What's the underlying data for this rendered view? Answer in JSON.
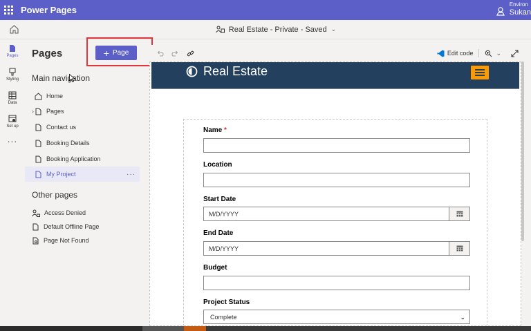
{
  "app": {
    "title": "Power Pages"
  },
  "environment": {
    "label": "Environ",
    "user": "Sukan"
  },
  "site": {
    "status": "Real Estate - Private - Saved"
  },
  "rail": {
    "items": [
      {
        "label": "Pages",
        "icon": "pages-icon"
      },
      {
        "label": "Styling",
        "icon": "brush-icon"
      },
      {
        "label": "Data",
        "icon": "table-icon"
      },
      {
        "label": "Set up",
        "icon": "setup-icon"
      }
    ],
    "more": "..."
  },
  "panel": {
    "title": "Pages",
    "add_button": "Page",
    "main_nav_title": "Main navigation",
    "main_nav": [
      {
        "label": "Home",
        "icon": "home-icon"
      },
      {
        "label": "Pages",
        "icon": "page-icon",
        "expandable": true
      },
      {
        "label": "Contact us",
        "icon": "page-icon"
      },
      {
        "label": "Booking Details",
        "icon": "page-icon"
      },
      {
        "label": "Booking Application",
        "icon": "page-icon"
      },
      {
        "label": "My Project",
        "icon": "page-icon",
        "selected": true
      }
    ],
    "other_title": "Other pages",
    "other_pages": [
      {
        "label": "Access Denied",
        "icon": "person-lock-icon"
      },
      {
        "label": "Default Offline Page",
        "icon": "page-icon"
      },
      {
        "label": "Page Not Found",
        "icon": "page-search-icon"
      }
    ],
    "more_dots": "···"
  },
  "toolbar": {
    "edit_code": "Edit code"
  },
  "preview": {
    "site_name": "Real Estate",
    "form": {
      "name_label": "Name",
      "required_mark": "*",
      "location_label": "Location",
      "start_label": "Start Date",
      "start_placeholder": "M/D/YYYY",
      "end_label": "End Date",
      "end_placeholder": "M/D/YYYY",
      "budget_label": "Budget",
      "status_label": "Project Status",
      "status_value": "Complete"
    }
  },
  "colors": {
    "brand": "#5b5fc7",
    "site_header": "#23415e",
    "menu_button": "#ff9900",
    "highlight": "#e2353b"
  }
}
